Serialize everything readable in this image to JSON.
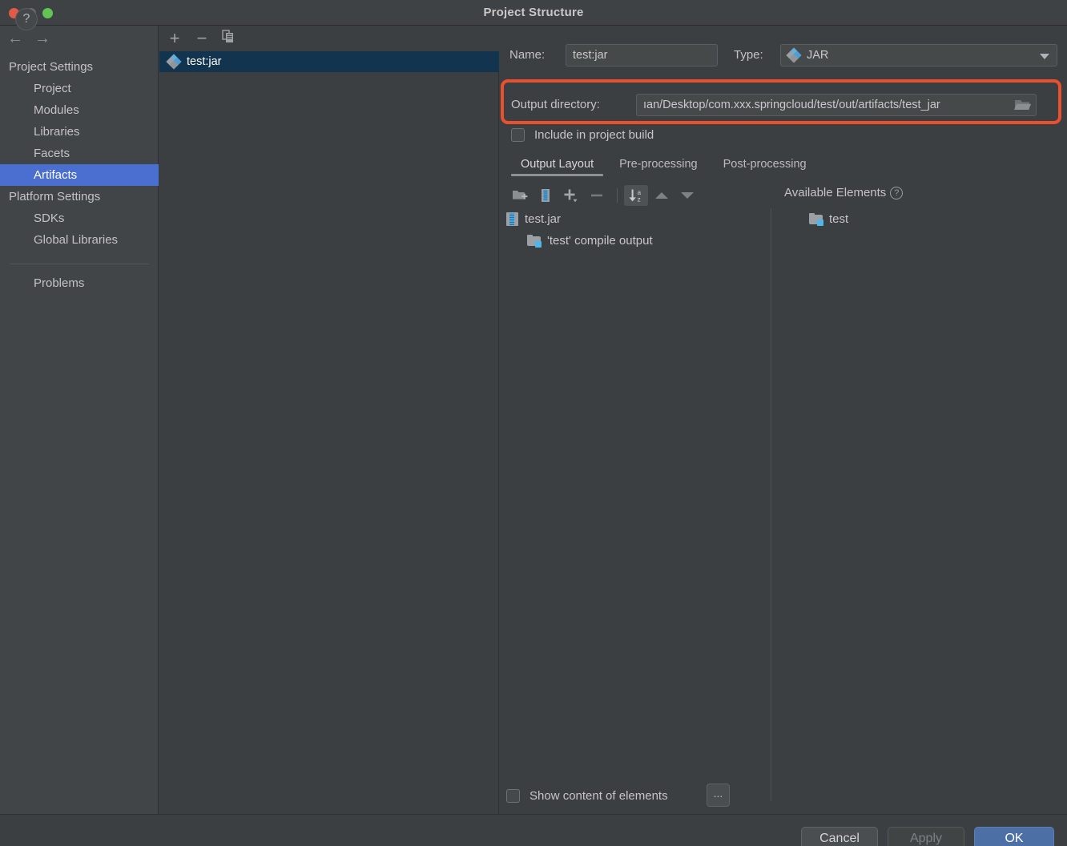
{
  "window": {
    "title": "Project Structure",
    "traffic_lights": [
      "close-red",
      "minimize-gray",
      "zoom-green"
    ]
  },
  "sidebar": {
    "nav_back_icon": "←",
    "nav_forward_icon": "→",
    "groups": [
      {
        "label": "Project Settings",
        "items": [
          {
            "label": "Project",
            "selected": false
          },
          {
            "label": "Modules",
            "selected": false
          },
          {
            "label": "Libraries",
            "selected": false
          },
          {
            "label": "Facets",
            "selected": false
          },
          {
            "label": "Artifacts",
            "selected": true
          }
        ]
      },
      {
        "label": "Platform Settings",
        "items": [
          {
            "label": "SDKs",
            "selected": false
          },
          {
            "label": "Global Libraries",
            "selected": false
          }
        ]
      }
    ],
    "problems_label": "Problems"
  },
  "artifact_list": {
    "toolbar": {
      "add_label": "+",
      "remove_label": "−",
      "copy_label": "copy-icon"
    },
    "items": [
      {
        "label": "test:jar",
        "icon": "jar-artifact-icon",
        "selected": true
      }
    ]
  },
  "detail": {
    "name_label": "Name:",
    "name_value": "test:jar",
    "type_label": "Type:",
    "type_value": "JAR",
    "type_icon": "jar-artifact-icon",
    "output_directory_label": "Output directory:",
    "output_directory_value": "ıan/Desktop/com.xxx.springcloud/test/out/artifacts/test_jar",
    "browse_icon": "folder-open-icon",
    "include_in_build_label": "Include in project build",
    "include_in_build_checked": false,
    "tabs": [
      {
        "label": "Output Layout",
        "active": true
      },
      {
        "label": "Pre-processing",
        "active": false
      },
      {
        "label": "Post-processing",
        "active": false
      }
    ],
    "layout_toolbar": [
      {
        "name": "add-directory-icon",
        "active": false
      },
      {
        "name": "add-archive-icon",
        "active": false
      },
      {
        "name": "add-element-icon",
        "active": false
      },
      {
        "name": "remove-element-icon",
        "active": false
      },
      {
        "name": "sort-alphabetically-icon",
        "active": true
      },
      {
        "name": "move-up-icon",
        "active": false
      },
      {
        "name": "move-down-icon",
        "active": false
      }
    ],
    "output_tree": [
      {
        "label": "test.jar",
        "icon": "archive-icon",
        "depth": 0
      },
      {
        "label": "'test' compile output",
        "icon": "module-output-icon",
        "depth": 1
      }
    ],
    "available_elements_label": "Available Elements",
    "available_help_icon": "?",
    "available_tree": [
      {
        "label": "test",
        "icon": "module-output-icon",
        "depth": 1
      }
    ],
    "show_content_label": "Show content of elements",
    "show_content_checked": false,
    "more_button_label": "..."
  },
  "footer": {
    "help_label": "?",
    "cancel_label": "Cancel",
    "apply_label": "Apply",
    "ok_label": "OK"
  },
  "annotation": {
    "highlight_color": "#e8502e",
    "target": "output-directory-row"
  }
}
